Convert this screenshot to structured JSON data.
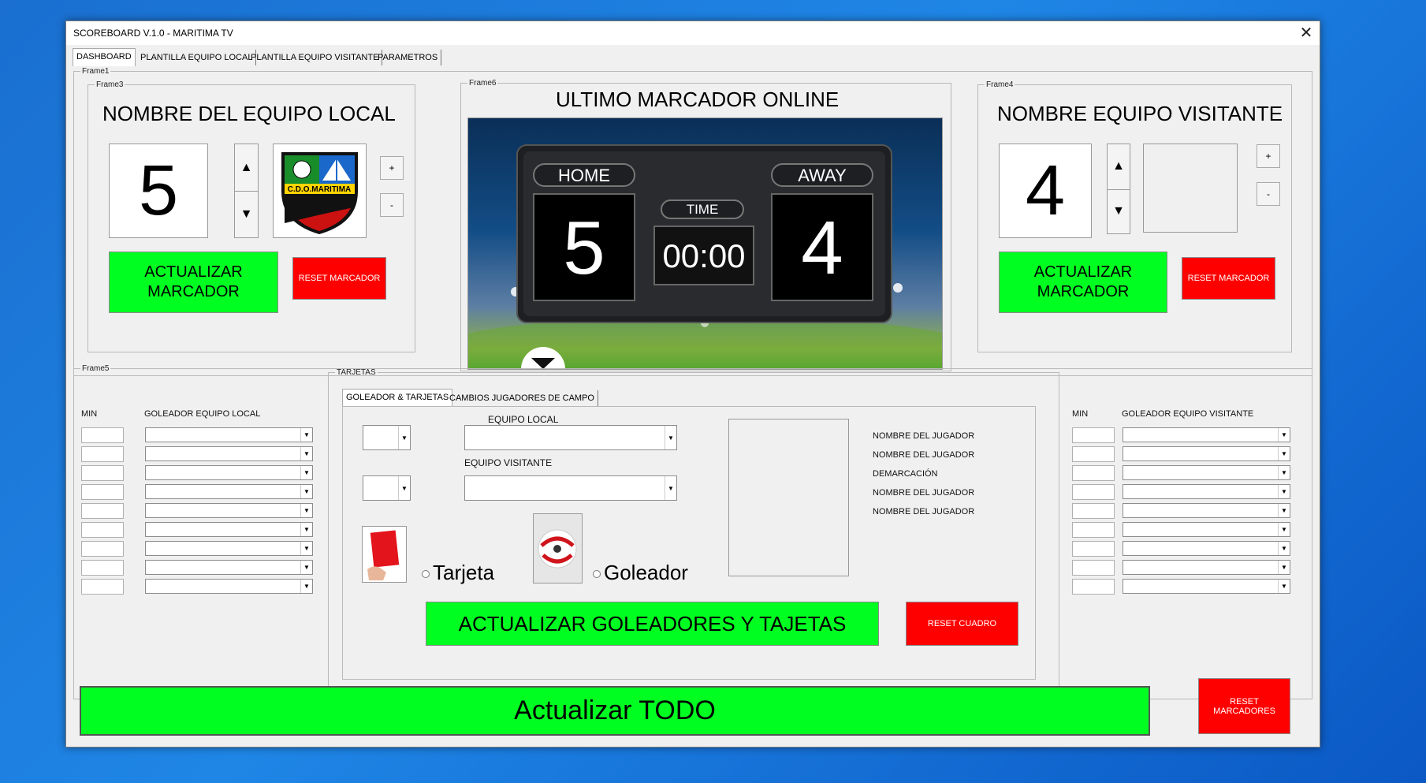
{
  "window": {
    "title": "SCOREBOARD V.1.0 - MARITIMA TV",
    "close_label": "✕"
  },
  "tabs": [
    "DASHBOARD",
    "PLANTILLA EQUIPO LOCAL",
    "PLANTILLA EQUIPO VISITANTE",
    "PARAMETROS"
  ],
  "frames": {
    "frame1": "Frame1",
    "frame3": "Frame3",
    "frame4": "Frame4",
    "frame5": "Frame5",
    "frame6": "Frame6",
    "tarjetas": "TARJETAS"
  },
  "local": {
    "title": "NOMBRE DEL EQUIPO LOCAL",
    "score": "5",
    "update_label": "ACTUALIZAR MARCADOR",
    "reset_label": "RESET MARCADOR",
    "plus": "+",
    "minus": "-",
    "logo_text": "C.D.O.MARITIMA"
  },
  "visitor": {
    "title": "NOMBRE EQUIPO VISITANTE",
    "score": "4",
    "update_label": "ACTUALIZAR MARCADOR",
    "reset_label": "RESET MARCADOR",
    "plus": "+",
    "minus": "-"
  },
  "online": {
    "title": "ULTIMO MARCADOR ONLINE",
    "home_label": "HOME",
    "away_label": "AWAY",
    "time_label": "TIME",
    "home_score": "5",
    "away_score": "4",
    "time_value": "00:00"
  },
  "scorers_local": {
    "min_header": "MIN",
    "scorer_header": "GOLEADOR EQUIPO LOCAL"
  },
  "scorers_visitor": {
    "min_header": "MIN",
    "scorer_header": "GOLEADOR EQUIPO VISITANTE"
  },
  "cards": {
    "subtabs": [
      "GOLEADOR & TARJETAS",
      "CAMBIOS JUGADORES DE CAMPO"
    ],
    "local_label": "EQUIPO LOCAL",
    "visitor_label": "EQUIPO VISITANTE",
    "info_lines": [
      "NOMBRE DEL JUGADOR",
      "NOMBRE DEL JUGADOR",
      "DEMARCACIÓN",
      "NOMBRE DEL JUGADOR",
      "NOMBRE DEL JUGADOR"
    ],
    "card_option": "Tarjeta",
    "scorer_option": "Goleador",
    "update_label": "ACTUALIZAR GOLEADORES Y TAJETAS",
    "reset_label": "RESET CUADRO"
  },
  "footer": {
    "update_all_label": "Actualizar TODO",
    "reset_all_label": "RESET MARCADORES"
  },
  "colors": {
    "green": "#00ff21",
    "red": "#ff0000",
    "scoreboard_bg": "#1e1f22"
  }
}
